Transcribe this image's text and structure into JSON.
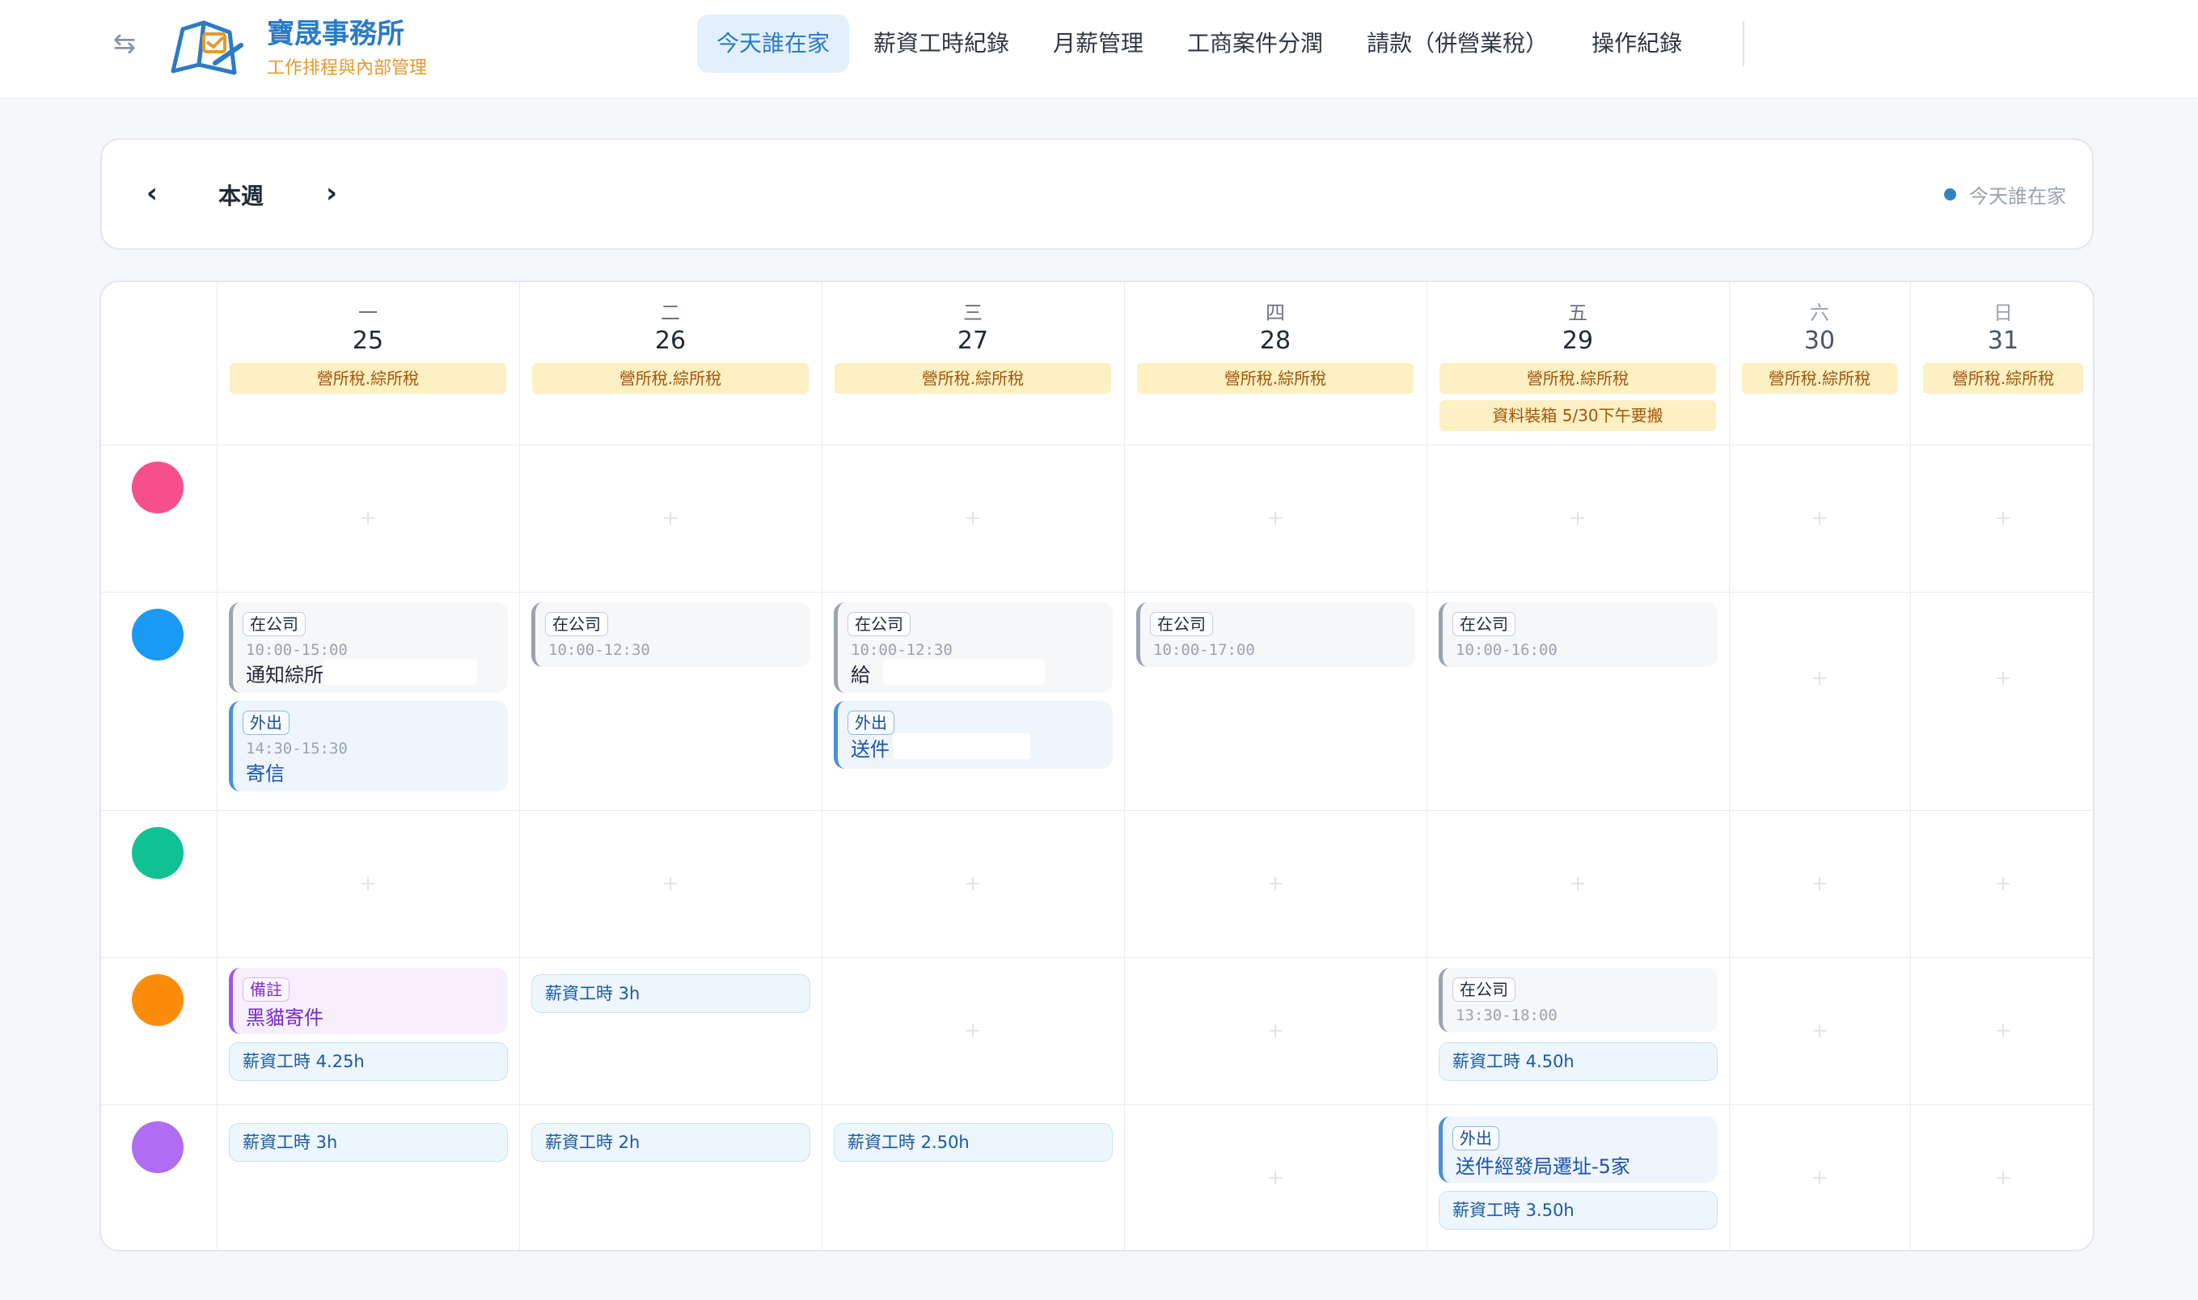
{
  "header": {
    "collapse_icon": "⇆",
    "brand_title": "寶晟事務所",
    "brand_subtitle": "工作排程與內部管理",
    "nav": [
      {
        "label": "今天誰在家",
        "active": true
      },
      {
        "label": "薪資工時紀錄",
        "active": false
      },
      {
        "label": "月薪管理",
        "active": false
      },
      {
        "label": "工商案件分潤",
        "active": false
      },
      {
        "label": "請款（併營業稅）",
        "active": false
      },
      {
        "label": "操作紀錄",
        "active": false
      }
    ]
  },
  "week": {
    "prev_icon": "‹",
    "label": "本週",
    "next_icon": "›",
    "legend": "今天誰在家",
    "legend_color": "#2b84c4"
  },
  "days": [
    {
      "dow": "一",
      "num": "25",
      "tags": [
        "營所稅.綜所稅"
      ]
    },
    {
      "dow": "二",
      "num": "26",
      "tags": [
        "營所稅.綜所稅"
      ]
    },
    {
      "dow": "三",
      "num": "27",
      "tags": [
        "營所稅.綜所稅"
      ]
    },
    {
      "dow": "四",
      "num": "28",
      "tags": [
        "營所稅.綜所稅"
      ]
    },
    {
      "dow": "五",
      "num": "29",
      "tags": [
        "營所稅.綜所稅",
        "資料裝箱 5/30下午要搬"
      ]
    },
    {
      "dow": "六",
      "num": "30",
      "tags": [
        "營所稅.綜所稅"
      ]
    },
    {
      "dow": "日",
      "num": "31",
      "tags": [
        "營所稅.綜所稅"
      ]
    }
  ],
  "staff_colors": [
    "#f5508b",
    "#1a9af5",
    "#0fc193",
    "#fb8c0a",
    "#b06cf2"
  ],
  "add_icon": "+",
  "events": {
    "r1_mon_office": {
      "badge": "在公司",
      "time": "10:00-15:00",
      "title": "通知綜所"
    },
    "r1_mon_out": {
      "badge": "外出",
      "time": "14:30-15:30",
      "title": "寄信"
    },
    "r1_tue_office": {
      "badge": "在公司",
      "time": "10:00-12:30"
    },
    "r1_wed_office": {
      "badge": "在公司",
      "time": "10:00-12:30",
      "title": "給"
    },
    "r1_wed_out": {
      "badge": "外出",
      "title": "送件"
    },
    "r1_thu_office": {
      "badge": "在公司",
      "time": "10:00-17:00"
    },
    "r1_fri_office": {
      "badge": "在公司",
      "time": "10:00-16:00"
    },
    "r3_mon_note": {
      "badge": "備註",
      "title": "黑貓寄件"
    },
    "r3_mon_hours": "薪資工時 4.25h",
    "r3_tue_hours": "薪資工時 3h",
    "r3_fri_office": {
      "badge": "在公司",
      "time": "13:30-18:00"
    },
    "r3_fri_hours": "薪資工時 4.50h",
    "r4_mon_hours": "薪資工時 3h",
    "r4_tue_hours": "薪資工時 2h",
    "r4_wed_hours": "薪資工時 2.50h",
    "r4_fri_out": {
      "badge": "外出",
      "title": "送件經發局遷址-5家"
    },
    "r4_fri_hours": "薪資工時 3.50h"
  }
}
